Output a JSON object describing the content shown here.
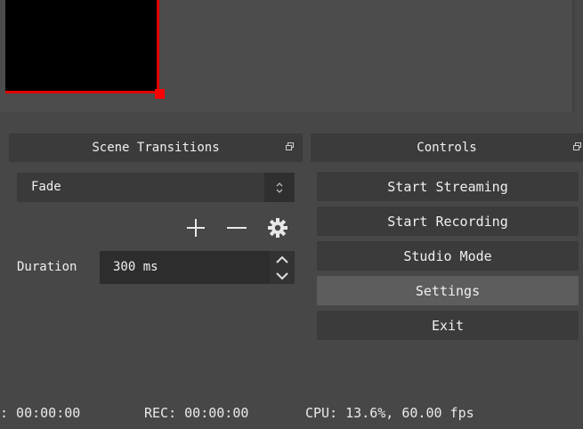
{
  "transitions": {
    "title": "Scene Transitions",
    "selected": "Fade",
    "duration_label": "Duration",
    "duration_value": "300 ms"
  },
  "controls": {
    "title": "Controls",
    "buttons": [
      {
        "label": "Start Streaming"
      },
      {
        "label": "Start Recording"
      },
      {
        "label": "Studio Mode"
      },
      {
        "label": "Settings"
      },
      {
        "label": "Exit"
      }
    ]
  },
  "status": {
    "live": ": 00:00:00",
    "rec": "REC: 00:00:00",
    "cpu": "CPU: 13.6%, 60.00 fps"
  },
  "colors": {
    "background": "#474747",
    "selection_border": "#e00000",
    "hover_button": "#5d5d5d"
  }
}
